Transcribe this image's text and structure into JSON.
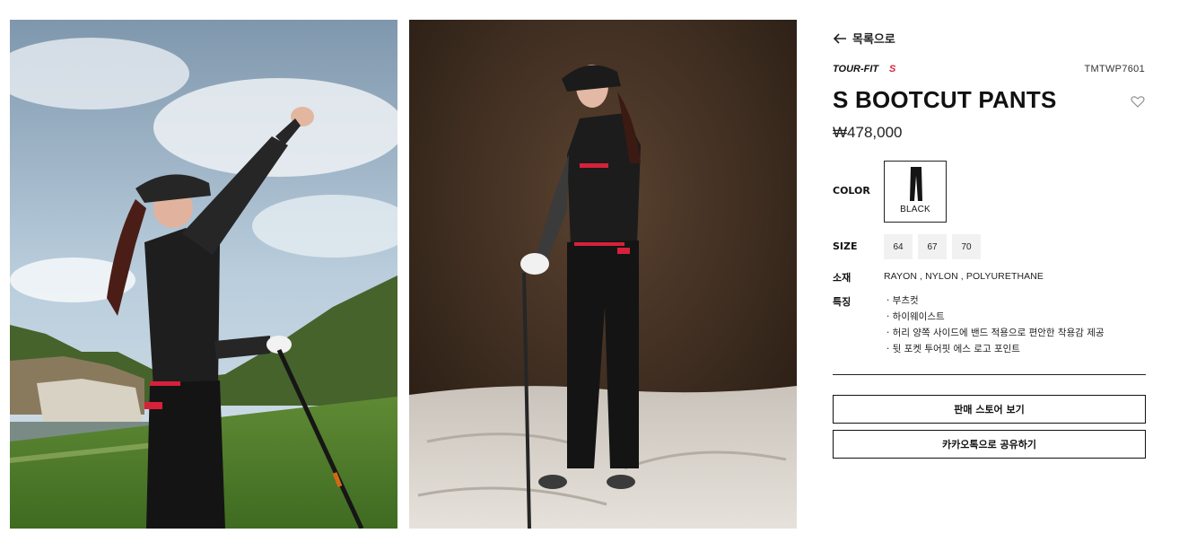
{
  "navigation": {
    "back_label": "목록으로",
    "back_icon": "arrow-left-icon"
  },
  "product": {
    "brand": "TOUR-FIT S",
    "sku": "TMTWP7601",
    "name": "S BOOTCUT PANTS",
    "price": "₩478,000",
    "wishlist_icon": "heart-outline-icon"
  },
  "options": {
    "color_label": "COLOR",
    "colors": [
      {
        "name": "BLACK",
        "selected": true
      }
    ],
    "size_label": "SIZE",
    "sizes": [
      "64",
      "67",
      "70"
    ]
  },
  "details": {
    "material_label": "소재",
    "material_value": "RAYON , NYLON , POLYURETHANE",
    "feature_label": "특징",
    "features": [
      "· 부츠컷",
      "· 하이웨이스트",
      "· 허리 양쪽 사이드에 밴드 적용으로 편안한 착용감 제공",
      "· 뒷 포켓 투어핏 에스 로고 포인트"
    ]
  },
  "actions": {
    "store_button": "판매 스토어 보기",
    "share_button": "카카오톡으로 공유하기"
  },
  "colors": {
    "accent": "#d6213a",
    "text": "#111111",
    "size_chip_bg": "#f1f1f1",
    "studio_backdrop": "#3a2a1e",
    "sky": "#aec7da"
  }
}
